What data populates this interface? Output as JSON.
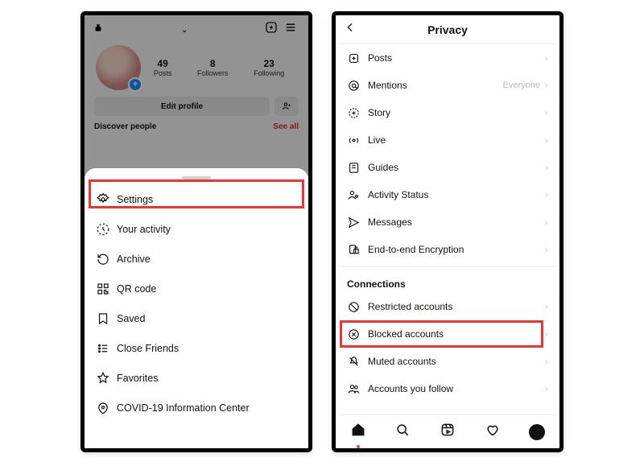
{
  "left": {
    "profile": {
      "username": "",
      "stats": {
        "posts": "49",
        "posts_label": "Posts",
        "followers": "8",
        "followers_label": "Followers",
        "following": "23",
        "following_label": "Following"
      },
      "edit_label": "Edit profile",
      "discover_label": "Discover people",
      "see_all": "See all"
    },
    "sheet": {
      "items": [
        {
          "label": "Settings"
        },
        {
          "label": "Your activity"
        },
        {
          "label": "Archive"
        },
        {
          "label": "QR code"
        },
        {
          "label": "Saved"
        },
        {
          "label": "Close Friends"
        },
        {
          "label": "Favorites"
        },
        {
          "label": "COVID-19 Information Center"
        }
      ]
    }
  },
  "right": {
    "title": "Privacy",
    "items": [
      {
        "label": "Posts",
        "value": ""
      },
      {
        "label": "Mentions",
        "value": "Everyone"
      },
      {
        "label": "Story",
        "value": ""
      },
      {
        "label": "Live",
        "value": ""
      },
      {
        "label": "Guides",
        "value": ""
      },
      {
        "label": "Activity Status",
        "value": ""
      },
      {
        "label": "Messages",
        "value": ""
      },
      {
        "label": "End-to-end Encryption",
        "value": ""
      }
    ],
    "section": "Connections",
    "connections": [
      {
        "label": "Restricted accounts"
      },
      {
        "label": "Blocked accounts"
      },
      {
        "label": "Muted accounts"
      },
      {
        "label": "Accounts you follow"
      }
    ]
  }
}
